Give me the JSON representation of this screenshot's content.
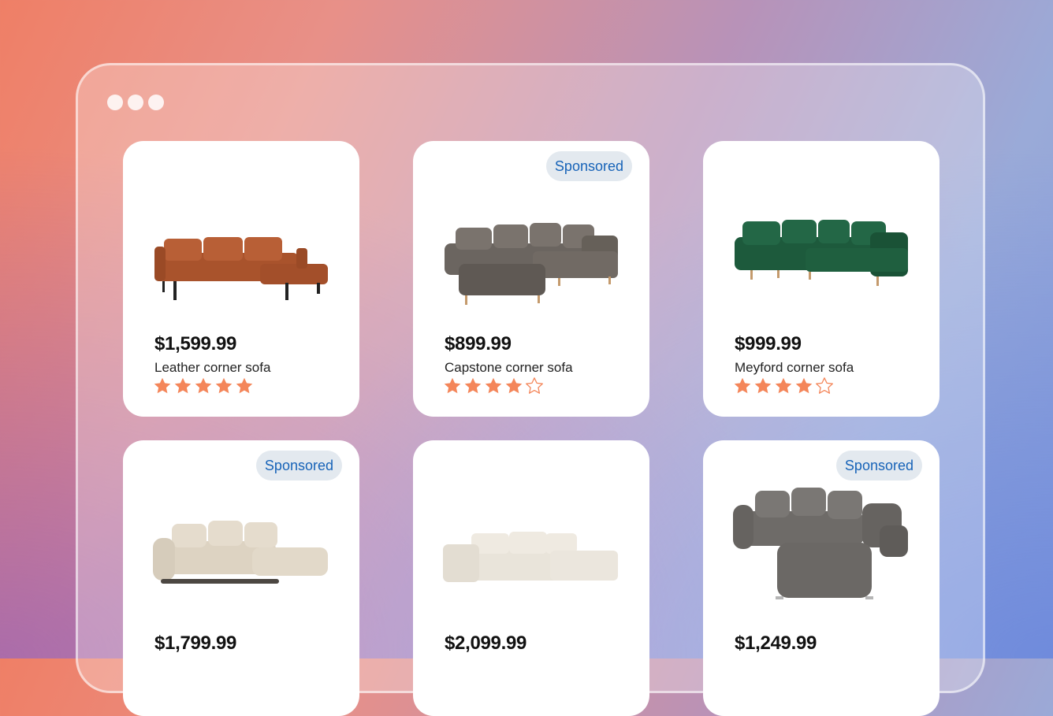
{
  "window": {
    "dots": 3
  },
  "colors": {
    "star": "#f4865a",
    "badge_bg": "#e3e9ef",
    "badge_text": "#1763b8"
  },
  "products": [
    {
      "price": "$1,599.99",
      "name": "Leather corner sofa",
      "rating": 5,
      "sponsored": false,
      "sofa_color": "#a9532c",
      "image_icon": "leather-sofa-image"
    },
    {
      "price": "$899.99",
      "name": "Capstone corner sofa",
      "rating": 4,
      "sponsored": true,
      "badge": "Sponsored",
      "sofa_color": "#6b6560",
      "image_icon": "grey-corner-sofa-image"
    },
    {
      "price": "$999.99",
      "name": "Meyford corner sofa",
      "rating": 4,
      "sponsored": false,
      "sofa_color": "#1d5a3c",
      "image_icon": "green-corner-sofa-image"
    },
    {
      "price": "$1,799.99",
      "name": "",
      "rating": 0,
      "sponsored": true,
      "badge": "Sponsored",
      "sofa_color": "#ddd3c2",
      "image_icon": "beige-sofa-image"
    },
    {
      "price": "$2,099.99",
      "name": "",
      "rating": 0,
      "sponsored": false,
      "sofa_color": "#e9e4da",
      "image_icon": "cream-sofa-image"
    },
    {
      "price": "$1,249.99",
      "name": "",
      "rating": 0,
      "sponsored": true,
      "badge": "Sponsored",
      "sofa_color": "#6e6b68",
      "image_icon": "charcoal-sofa-image"
    }
  ]
}
